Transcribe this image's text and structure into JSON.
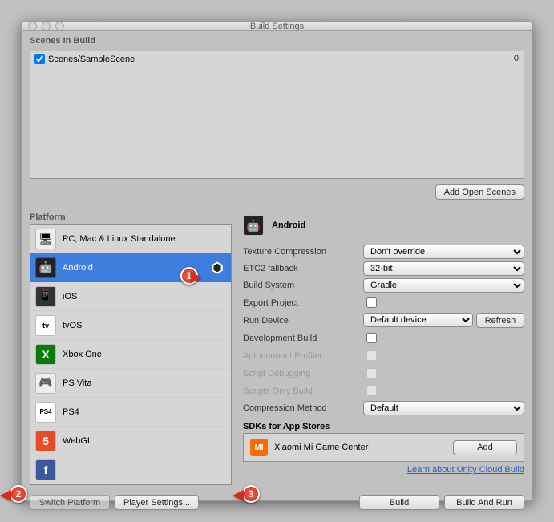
{
  "window": {
    "title": "Build Settings"
  },
  "scenes": {
    "label": "Scenes In Build",
    "items": [
      {
        "name": "Scenes/SampleScene",
        "index": "0",
        "checked": true
      }
    ],
    "add_open": "Add Open Scenes"
  },
  "platform": {
    "label": "Platform",
    "selected_index": 1,
    "items": [
      {
        "name": "PC, Mac & Linux Standalone",
        "icon": "🖥"
      },
      {
        "name": "Android",
        "icon": "🤖"
      },
      {
        "name": "iOS",
        "icon": "📱"
      },
      {
        "name": "tvOS",
        "icon": "📺"
      },
      {
        "name": "Xbox One",
        "icon": "X"
      },
      {
        "name": "PS Vita",
        "icon": "🎮"
      },
      {
        "name": "PS4",
        "icon": "PS4"
      },
      {
        "name": "WebGL",
        "icon": "5"
      }
    ]
  },
  "right": {
    "title": "Android",
    "settings": {
      "texture_compression": {
        "label": "Texture Compression",
        "value": "Don't override"
      },
      "etc2": {
        "label": "ETC2 fallback",
        "value": "32-bit"
      },
      "build_system": {
        "label": "Build System",
        "value": "Gradle"
      },
      "export_project": {
        "label": "Export Project"
      },
      "run_device": {
        "label": "Run Device",
        "value": "Default device",
        "refresh": "Refresh"
      },
      "development_build": {
        "label": "Development Build"
      },
      "autoconnect": {
        "label": "Autoconnect Profiler"
      },
      "script_debug": {
        "label": "Script Debugging"
      },
      "scripts_only": {
        "label": "Scripts Only Build"
      },
      "compression_method": {
        "label": "Compression Method",
        "value": "Default"
      }
    },
    "sdks": {
      "label": "SDKs for App Stores",
      "item": "Xiaomi Mi Game Center",
      "add": "Add"
    },
    "cloud_link": "Learn about Unity Cloud Build"
  },
  "bottom": {
    "switch_platform": "Switch Platform",
    "player_settings": "Player Settings...",
    "build": "Build",
    "build_run": "Build And Run"
  },
  "callouts": {
    "c1": "1",
    "c2": "2",
    "c3": "3"
  }
}
